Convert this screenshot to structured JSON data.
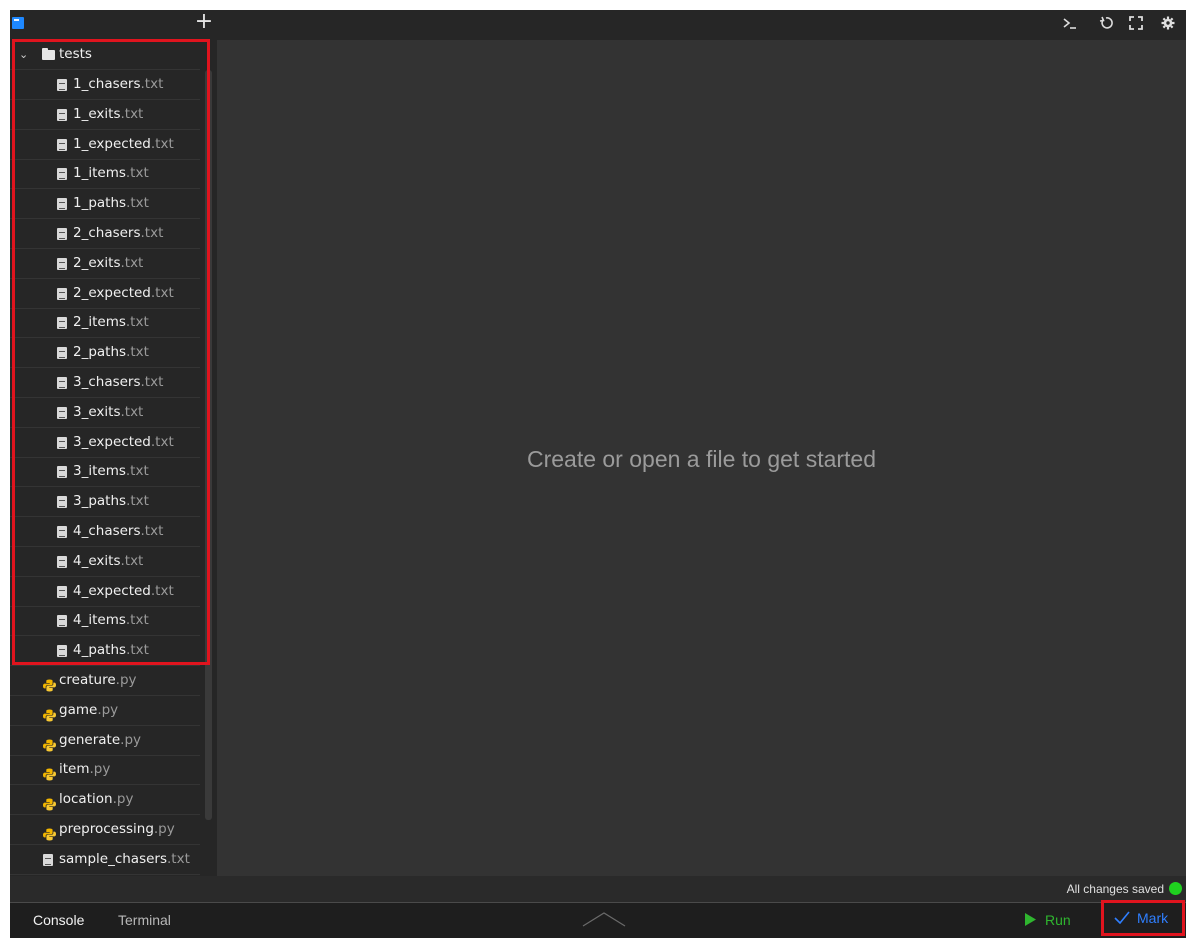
{
  "toolbar": {
    "add_label": "+",
    "icons": [
      "terminal-icon",
      "refresh-icon",
      "fullscreen-icon",
      "settings-icon"
    ]
  },
  "folder": {
    "name": "tests"
  },
  "test_files": [
    {
      "base": "1_chasers",
      "ext": ".txt"
    },
    {
      "base": "1_exits",
      "ext": ".txt"
    },
    {
      "base": "1_expected",
      "ext": ".txt"
    },
    {
      "base": "1_items",
      "ext": ".txt"
    },
    {
      "base": "1_paths",
      "ext": ".txt"
    },
    {
      "base": "2_chasers",
      "ext": ".txt"
    },
    {
      "base": "2_exits",
      "ext": ".txt"
    },
    {
      "base": "2_expected",
      "ext": ".txt"
    },
    {
      "base": "2_items",
      "ext": ".txt"
    },
    {
      "base": "2_paths",
      "ext": ".txt"
    },
    {
      "base": "3_chasers",
      "ext": ".txt"
    },
    {
      "base": "3_exits",
      "ext": ".txt"
    },
    {
      "base": "3_expected",
      "ext": ".txt"
    },
    {
      "base": "3_items",
      "ext": ".txt"
    },
    {
      "base": "3_paths",
      "ext": ".txt"
    },
    {
      "base": "4_chasers",
      "ext": ".txt"
    },
    {
      "base": "4_exits",
      "ext": ".txt"
    },
    {
      "base": "4_expected",
      "ext": ".txt"
    },
    {
      "base": "4_items",
      "ext": ".txt"
    },
    {
      "base": "4_paths",
      "ext": ".txt"
    }
  ],
  "root_files": [
    {
      "base": "creature",
      "ext": ".py",
      "type": "python"
    },
    {
      "base": "game",
      "ext": ".py",
      "type": "python"
    },
    {
      "base": "generate",
      "ext": ".py",
      "type": "python"
    },
    {
      "base": "item",
      "ext": ".py",
      "type": "python"
    },
    {
      "base": "location",
      "ext": ".py",
      "type": "python"
    },
    {
      "base": "preprocessing",
      "ext": ".py",
      "type": "python"
    },
    {
      "base": "sample_chasers",
      "ext": ".txt",
      "type": "text"
    }
  ],
  "editor": {
    "empty_message": "Create or open a file to get started"
  },
  "status": {
    "saved_text": "All changes saved"
  },
  "bottom": {
    "console_label": "Console",
    "terminal_label": "Terminal",
    "run_label": "Run",
    "mark_label": "Mark"
  },
  "colors": {
    "accent_blue": "#2f7fff",
    "run_green": "#2fb52f",
    "saved_green": "#1fd11f",
    "highlight_red": "#e0141e"
  }
}
